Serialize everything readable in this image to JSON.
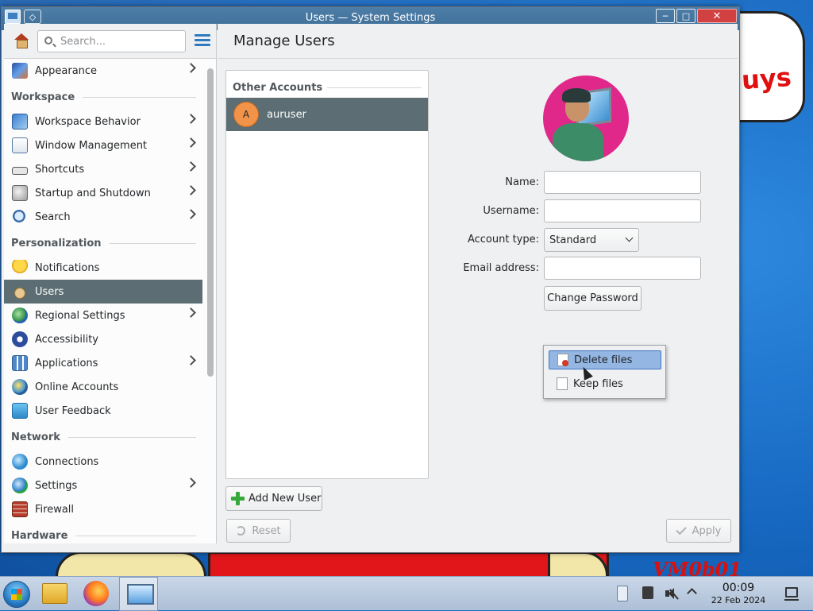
{
  "window": {
    "title": "Users — System Settings",
    "minimize_glyph": "─",
    "maximize_glyph": "□",
    "close_glyph": "✕",
    "menu_glyph": "◇"
  },
  "sidebar": {
    "search_placeholder": "Search...",
    "top_item": {
      "label": "Appearance",
      "icon": "appearance-icon",
      "has_submenu": true
    },
    "sections": {
      "workspace": "Workspace",
      "personalization": "Personalization",
      "network": "Network",
      "hardware": "Hardware"
    },
    "workspace_items": [
      {
        "label": "Workspace Behavior",
        "icon": "workspace-behavior-icon",
        "has_submenu": true
      },
      {
        "label": "Window Management",
        "icon": "window-management-icon",
        "has_submenu": true
      },
      {
        "label": "Shortcuts",
        "icon": "keyboard-icon",
        "has_submenu": true
      },
      {
        "label": "Startup and Shutdown",
        "icon": "startup-icon",
        "has_submenu": true
      },
      {
        "label": "Search",
        "icon": "search-icon",
        "has_submenu": true
      }
    ],
    "personalization_items": [
      {
        "label": "Notifications",
        "icon": "bell-icon",
        "has_submenu": false
      },
      {
        "label": "Users",
        "icon": "users-icon",
        "has_submenu": false,
        "active": true
      },
      {
        "label": "Regional Settings",
        "icon": "globe-icon",
        "has_submenu": true
      },
      {
        "label": "Accessibility",
        "icon": "accessibility-icon",
        "has_submenu": false
      },
      {
        "label": "Applications",
        "icon": "applications-icon",
        "has_submenu": true
      },
      {
        "label": "Online Accounts",
        "icon": "online-accounts-icon",
        "has_submenu": false
      },
      {
        "label": "User Feedback",
        "icon": "feedback-icon",
        "has_submenu": false
      }
    ],
    "network_items": [
      {
        "label": "Connections",
        "icon": "connections-icon",
        "has_submenu": false
      },
      {
        "label": "Settings",
        "icon": "network-settings-icon",
        "has_submenu": true
      },
      {
        "label": "Firewall",
        "icon": "firewall-icon",
        "has_submenu": false
      }
    ]
  },
  "main": {
    "title": "Manage Users",
    "accounts_section": "Other Accounts",
    "accounts": [
      {
        "initial": "A",
        "name": "auruser"
      }
    ],
    "add_user_label": "Add New User",
    "form": {
      "name_label": "Name:",
      "name_value": "",
      "username_label": "Username:",
      "username_value": "",
      "account_type_label": "Account type:",
      "account_type_value": "Standard",
      "email_label": "Email address:",
      "email_value": "",
      "change_password_label": "Change Password"
    },
    "delete_menu": {
      "items": [
        {
          "label": "Delete files",
          "highlighted": true
        },
        {
          "label": "Keep files",
          "highlighted": false
        }
      ]
    },
    "reset_label": "Reset",
    "apply_label": "Apply"
  },
  "taskbar": {
    "time": "00:09",
    "date": "22 Feb 2024"
  },
  "wallpaper": {
    "text_top": "uys",
    "text_bottom": "VM0b01"
  },
  "colors": {
    "titlebar": "#4d7ea8",
    "selection": "#5c6d73",
    "accent": "#2d7ac0",
    "avatar_orange": "#f2934a",
    "profile_pink": "#e0288a"
  }
}
